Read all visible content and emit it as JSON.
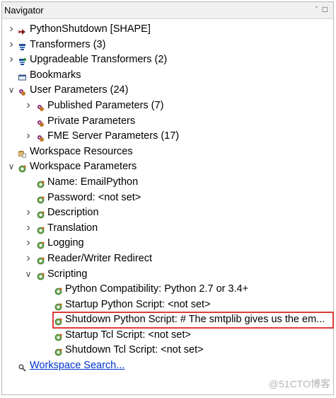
{
  "panel": {
    "title": "Navigator",
    "pin_glyph": "ˇ",
    "minimize_glyph": "□"
  },
  "tree": [
    {
      "level": 0,
      "expander": "collapsed",
      "icon": "python-shutdown-icon",
      "label": "PythonShutdown [SHAPE]",
      "name": "tree-item-pythonshutdown"
    },
    {
      "level": 0,
      "expander": "collapsed",
      "icon": "transformers-icon",
      "label": "Transformers (3)",
      "name": "tree-item-transformers"
    },
    {
      "level": 0,
      "expander": "collapsed",
      "icon": "upgradeable-transformers-icon",
      "label": "Upgradeable Transformers (2)",
      "name": "tree-item-upgradeable-transformers"
    },
    {
      "level": 0,
      "expander": "none",
      "icon": "bookmarks-icon",
      "label": "Bookmarks",
      "name": "tree-item-bookmarks"
    },
    {
      "level": 0,
      "expander": "expanded",
      "icon": "user-parameters-icon",
      "label": "User Parameters (24)",
      "name": "tree-item-user-parameters"
    },
    {
      "level": 1,
      "expander": "collapsed",
      "icon": "published-parameters-icon",
      "label": "Published Parameters (7)",
      "name": "tree-item-published-parameters"
    },
    {
      "level": 1,
      "expander": "none",
      "icon": "private-parameters-icon",
      "label": "Private Parameters",
      "name": "tree-item-private-parameters"
    },
    {
      "level": 1,
      "expander": "collapsed",
      "icon": "fme-server-parameters-icon",
      "label": "FME Server Parameters (17)",
      "name": "tree-item-fme-server-parameters"
    },
    {
      "level": 0,
      "expander": "none",
      "icon": "workspace-resources-icon",
      "label": "Workspace Resources",
      "name": "tree-item-workspace-resources"
    },
    {
      "level": 0,
      "expander": "expanded",
      "icon": "workspace-parameters-icon",
      "label": "Workspace Parameters",
      "name": "tree-item-workspace-parameters"
    },
    {
      "level": 1,
      "expander": "none",
      "icon": "parameter-icon",
      "label": "Name: EmailPython",
      "name": "tree-item-name"
    },
    {
      "level": 1,
      "expander": "none",
      "icon": "parameter-icon",
      "label": "Password: <not set>",
      "name": "tree-item-password"
    },
    {
      "level": 1,
      "expander": "collapsed",
      "icon": "parameter-group-icon",
      "label": "Description",
      "name": "tree-item-description"
    },
    {
      "level": 1,
      "expander": "collapsed",
      "icon": "parameter-group-icon",
      "label": "Translation",
      "name": "tree-item-translation"
    },
    {
      "level": 1,
      "expander": "collapsed",
      "icon": "parameter-group-icon",
      "label": "Logging",
      "name": "tree-item-logging"
    },
    {
      "level": 1,
      "expander": "collapsed",
      "icon": "parameter-group-icon",
      "label": "Reader/Writer Redirect",
      "name": "tree-item-reader-writer-redirect"
    },
    {
      "level": 1,
      "expander": "expanded",
      "icon": "parameter-group-icon",
      "label": "Scripting",
      "name": "tree-item-scripting"
    },
    {
      "level": 2,
      "expander": "none",
      "icon": "parameter-icon",
      "label": "Python Compatibility: Python 2.7 or 3.4+",
      "name": "tree-item-python-compatibility"
    },
    {
      "level": 2,
      "expander": "none",
      "icon": "parameter-icon",
      "label": "Startup Python Script: <not set>",
      "name": "tree-item-startup-python-script"
    },
    {
      "level": 2,
      "expander": "none",
      "icon": "parameter-icon",
      "label": "Shutdown Python Script: # The smtplib gives us the em...",
      "name": "tree-item-shutdown-python-script",
      "highlighted": true
    },
    {
      "level": 2,
      "expander": "none",
      "icon": "parameter-icon",
      "label": "Startup Tcl Script: <not set>",
      "name": "tree-item-startup-tcl-script"
    },
    {
      "level": 2,
      "expander": "none",
      "icon": "parameter-icon",
      "label": "Shutdown Tcl Script: <not set>",
      "name": "tree-item-shutdown-tcl-script"
    },
    {
      "level": 0,
      "expander": "none",
      "icon": "search-icon",
      "label": "Workspace Search...",
      "name": "workspace-search-link",
      "link": true
    }
  ],
  "highlight_color": "#e03a3a",
  "link_color": "#0033cc",
  "watermark": "@51CTO博客"
}
